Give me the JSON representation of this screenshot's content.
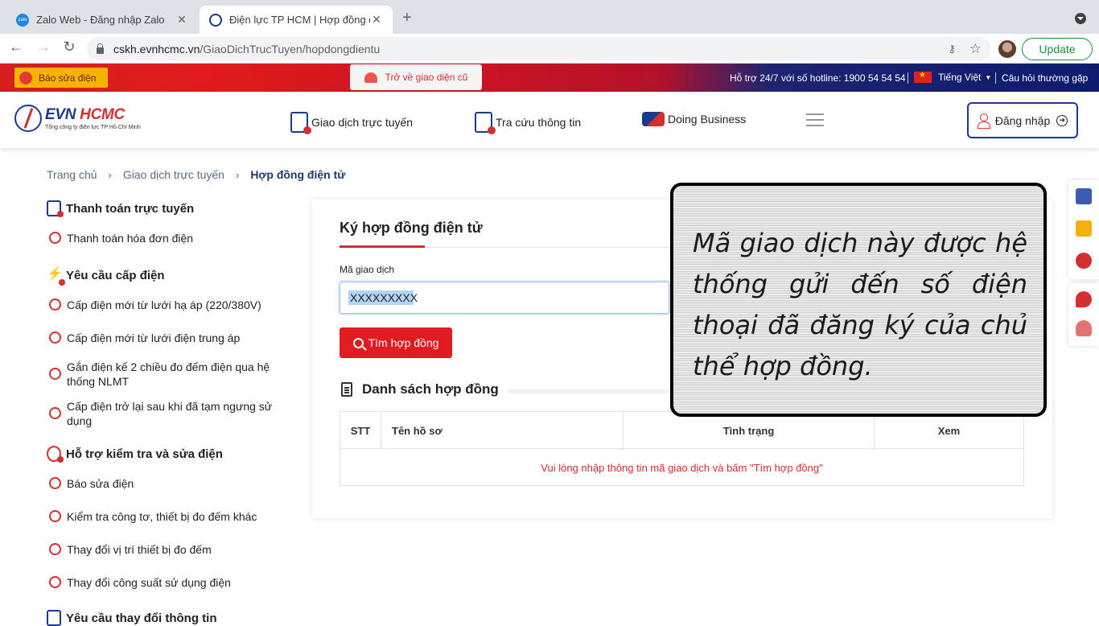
{
  "browser": {
    "tabs": [
      {
        "title": "Zalo Web - Đăng nhập Zalo",
        "favicon": "zalo-icon"
      },
      {
        "title": "Điện lực TP HCM | Hợp đồng đ",
        "favicon": "evn-icon"
      }
    ],
    "url_host": "cskh.evnhcmc.vn",
    "url_path": "/GiaoDichTrucTuyen/hopdongdientu",
    "update_label": "Update"
  },
  "topbar": {
    "report_label": "Báo sửa điện",
    "old_ui_label": "Trở về giao diện cũ",
    "hotline": "Hỗ trợ 24/7 với số hotline: 1900 54 54 54",
    "language": "Tiếng Việt",
    "faq": "Câu hỏi thường gặp"
  },
  "header": {
    "logo_name_a": "EVN",
    "logo_name_b": "HCMC",
    "logo_sub": "Tổng công ty điện lực TP Hồ Chí Minh",
    "menu": [
      {
        "label": "Giao dịch trực tuyến"
      },
      {
        "label": "Tra cứu thông tin"
      },
      {
        "label": "Doing Business"
      }
    ],
    "login_label": "Đăng nhập"
  },
  "breadcrumb": [
    "Trang chủ",
    "Giao dịch trực tuyến",
    "Hợp đồng điện tử"
  ],
  "sidebar": {
    "groups": [
      {
        "title": "Thanh toán trực tuyến",
        "items": [
          "Thanh toán hóa đơn điện"
        ]
      },
      {
        "title": "Yêu cầu cấp điện",
        "items": [
          "Cấp điện mới từ lưới hạ áp (220/380V)",
          "Cấp điện mới từ lưới điện trung áp",
          "Gắn điện kế 2 chiều đo đếm điện qua hệ thống NLMT",
          "Cấp điện trở lại sau khi đã tạm ngưng sử dụng"
        ]
      },
      {
        "title": "Hỗ trợ kiểm tra và sửa điện",
        "items": [
          "Báo sửa điện",
          "Kiểm tra công tơ, thiết bị đo đếm khác",
          "Thay đổi vị trí thiết bị đo đếm",
          "Thay đổi công suất sử dụng điện"
        ]
      },
      {
        "title": "Yêu cầu thay đổi thông tin",
        "items": []
      }
    ]
  },
  "form": {
    "title": "Ký hợp đồng điện tử",
    "code_label": "Mã giao dịch",
    "code_value": "XXXXXXXXX",
    "search_label": "Tìm hợp đồng",
    "list_title": "Danh sách hợp đồng",
    "columns": [
      "STT",
      "Tên hồ sơ",
      "Tình trạng",
      "Xem"
    ],
    "empty_message": "Vui lòng nhập thông tin mã giao dịch và bấm \"Tìm hợp đồng\""
  },
  "note": {
    "text": "Mã giao dịch này được hệ thống gửi đến số điện thoại đã đăng ký của chủ thể hợp đồng."
  },
  "colors": {
    "brand_red": "#e01b22",
    "brand_blue": "#1a3a8f",
    "error_red": "#d32f2f"
  }
}
